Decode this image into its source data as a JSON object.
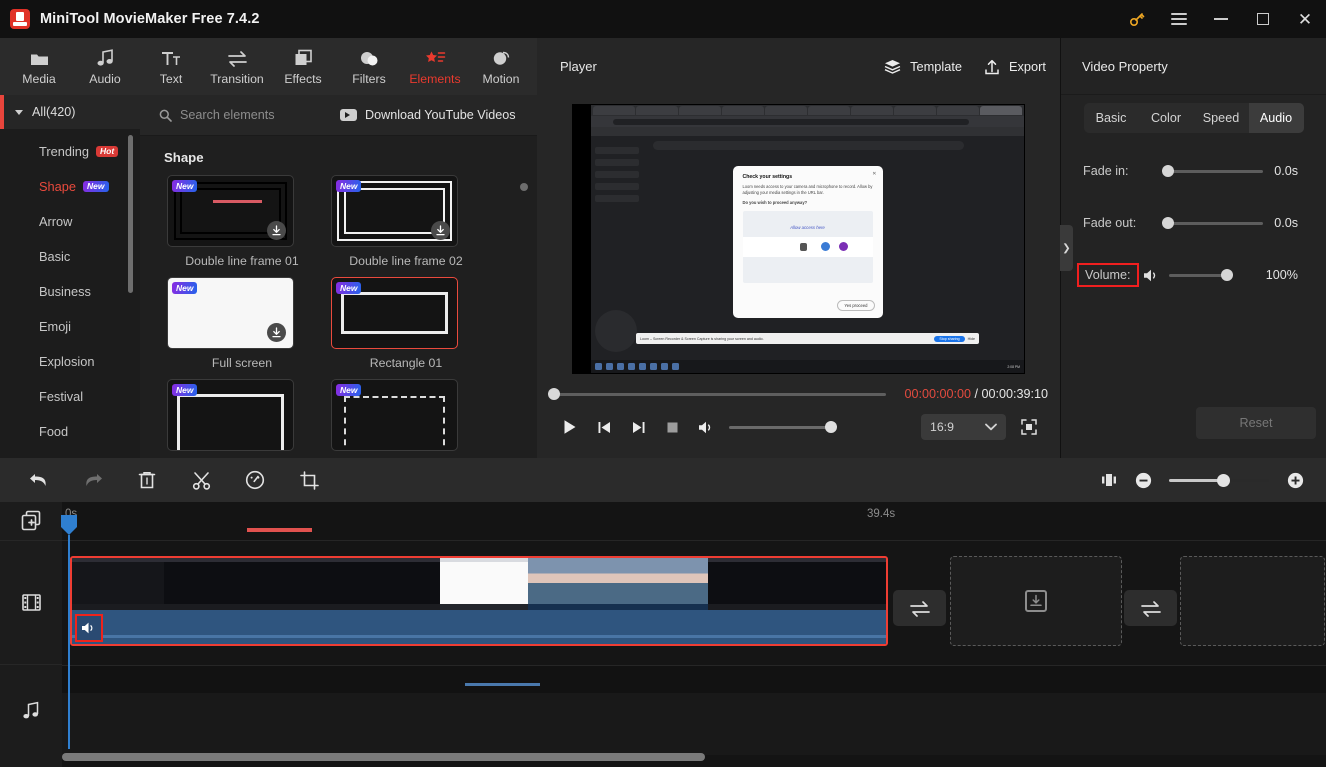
{
  "titlebar": {
    "app_name": "MiniTool MovieMaker Free 7.4.2",
    "logo_icon": "moviemaker-logo-icon",
    "buttons": [
      {
        "name": "key-icon",
        "label": ""
      },
      {
        "name": "menu-icon",
        "label": ""
      },
      {
        "name": "minimize-icon",
        "label": ""
      },
      {
        "name": "maximize-icon",
        "label": ""
      },
      {
        "name": "close-icon",
        "label": ""
      }
    ]
  },
  "toptabs": [
    {
      "label": "Media",
      "icon": "folder-icon",
      "active": false
    },
    {
      "label": "Audio",
      "icon": "music-note-icon",
      "active": false
    },
    {
      "label": "Text",
      "icon": "text-tt-icon",
      "active": false
    },
    {
      "label": "Transition",
      "icon": "swap-arrows-icon",
      "active": false
    },
    {
      "label": "Effects",
      "icon": "layers-square-icon",
      "active": false
    },
    {
      "label": "Filters",
      "icon": "two-circles-icon",
      "active": false
    },
    {
      "label": "Elements",
      "icon": "star-list-icon",
      "active": true
    },
    {
      "label": "Motion",
      "icon": "sphere-icon",
      "active": false
    }
  ],
  "categories": {
    "all_label": "All(420)",
    "items": [
      {
        "label": "Trending",
        "badge": "Hot",
        "badge_type": "hot",
        "selected": false
      },
      {
        "label": "Shape",
        "badge": "New",
        "badge_type": "new",
        "selected": true
      },
      {
        "label": "Arrow",
        "badge": "",
        "badge_type": "",
        "selected": false
      },
      {
        "label": "Basic",
        "badge": "",
        "badge_type": "",
        "selected": false
      },
      {
        "label": "Business",
        "badge": "",
        "badge_type": "",
        "selected": false
      },
      {
        "label": "Emoji",
        "badge": "",
        "badge_type": "",
        "selected": false
      },
      {
        "label": "Explosion",
        "badge": "",
        "badge_type": "",
        "selected": false
      },
      {
        "label": "Festival",
        "badge": "",
        "badge_type": "",
        "selected": false
      },
      {
        "label": "Food",
        "badge": "",
        "badge_type": "",
        "selected": false
      }
    ]
  },
  "elements": {
    "search_placeholder": "Search elements",
    "search_icon": "search-icon",
    "youtube_label": "Download YouTube Videos",
    "youtube_icon": "youtube-download-icon",
    "group_title": "Shape",
    "new_badge": "New",
    "items": [
      {
        "label": "Double line frame 01",
        "badge": "New",
        "downloadable": true,
        "selected": false,
        "style": "dbl1"
      },
      {
        "label": "Double line frame 02",
        "badge": "New",
        "downloadable": true,
        "selected": false,
        "style": "dbl2"
      },
      {
        "label": "Full screen",
        "badge": "New",
        "downloadable": true,
        "selected": false,
        "style": "white"
      },
      {
        "label": "Rectangle 01",
        "badge": "New",
        "downloadable": false,
        "selected": true,
        "style": "rect"
      },
      {
        "label": "",
        "badge": "New",
        "downloadable": false,
        "selected": false,
        "style": "half"
      },
      {
        "label": "",
        "badge": "New",
        "downloadable": false,
        "selected": false,
        "style": "half2"
      }
    ]
  },
  "player": {
    "title": "Player",
    "template_label": "Template",
    "template_icon": "layers-icon",
    "export_label": "Export",
    "export_icon": "upload-icon",
    "current_time": "00:00:00:00",
    "separator": "/",
    "total_time": "00:00:39:10",
    "aspect_ratio": "16:9",
    "controls": [
      {
        "name": "play-button",
        "icon": "play-icon"
      },
      {
        "name": "prev-frame-button",
        "icon": "step-backward-icon"
      },
      {
        "name": "next-frame-button",
        "icon": "step-forward-icon"
      },
      {
        "name": "stop-button",
        "icon": "stop-icon"
      },
      {
        "name": "volume-button",
        "icon": "speaker-icon"
      }
    ],
    "preview": {
      "dialog_title": "Check your settings",
      "dialog_body": "Loom needs access to your camera and microphone to record. Allow by adjusting your media settings in the URL bar.",
      "dialog_bold": "Do you wish to proceed anyway?",
      "dialog_image_label": "Allow access here",
      "dialog_button": "Yes proceed",
      "share_text": "Loom – Screen Recorder & Screen Capture is sharing your screen and audio.",
      "share_button": "Stop sharing",
      "share_hide": "Hide",
      "clock": "2:08 PM"
    }
  },
  "property": {
    "title": "Video Property",
    "tabs": [
      {
        "label": "Basic",
        "active": false
      },
      {
        "label": "Color",
        "active": false
      },
      {
        "label": "Speed",
        "active": false
      },
      {
        "label": "Audio",
        "active": true
      }
    ],
    "rows": [
      {
        "label": "Fade in:",
        "value": "0.0s",
        "knob_pct": 0,
        "highlighted": false,
        "has_speaker": false
      },
      {
        "label": "Fade out:",
        "value": "0.0s",
        "knob_pct": 0,
        "highlighted": false,
        "has_speaker": false
      },
      {
        "label": "Volume:",
        "value": "100%",
        "knob_pct": 100,
        "highlighted": true,
        "has_speaker": true
      }
    ],
    "reset_label": "Reset",
    "collapse_icon": "chevron-right-icon"
  },
  "edit_toolbar": {
    "buttons": [
      {
        "name": "undo-button",
        "icon": "undo-arrow-icon",
        "dim": false
      },
      {
        "name": "redo-button",
        "icon": "redo-arrow-icon",
        "dim": true
      },
      {
        "name": "delete-button",
        "icon": "trash-icon",
        "dim": false
      },
      {
        "name": "split-button",
        "icon": "scissors-icon",
        "dim": false
      },
      {
        "name": "speed-button",
        "icon": "speedometer-icon",
        "dim": false
      },
      {
        "name": "crop-button",
        "icon": "crop-icon",
        "dim": false
      }
    ],
    "fit_icon": "fit-timeline-icon",
    "zoom_out_icon": "zoom-out-icon",
    "zoom_in_icon": "zoom-in-icon"
  },
  "timeline": {
    "gutter": [
      {
        "name": "add-media-track-button",
        "icon": "add-media-icon"
      },
      {
        "name": "video-track-header",
        "icon": "film-strip-icon"
      },
      {
        "name": "audio-track-header",
        "icon": "music-note-icon"
      }
    ],
    "ruler": {
      "start_label": "0s",
      "end_label": "39.4s"
    },
    "clip": {
      "name": "video-clip-1",
      "mute_icon": "speaker-icon",
      "selected": true
    },
    "transition_icon": "transition-swap-icon",
    "drop_icon": "import-media-icon"
  },
  "colors": {
    "accent_red": "#ea3a2e",
    "highlight_red": "#f01f1f",
    "selection_red": "#ef3d33",
    "playhead_blue": "#2f7fd0",
    "clip_blue": "#2f557f",
    "badge_new_start": "#8a2be2",
    "badge_new_end": "#2563eb",
    "badge_hot": "#d93a36",
    "panel_bg": "#262626",
    "timeline_bg": "#141414"
  }
}
